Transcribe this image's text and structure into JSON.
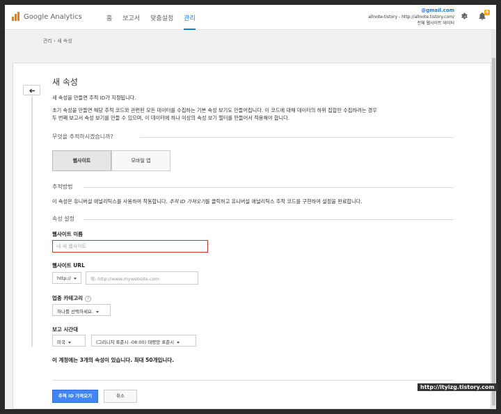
{
  "app": {
    "brand": "Google Analytics"
  },
  "nav": {
    "items": [
      "홈",
      "보고서",
      "맞춤설정",
      "관리"
    ],
    "active": "관리"
  },
  "account": {
    "email": "@gmail.com",
    "property": "allnote-tistory - http://allnote.tistory.com/",
    "view": "전체 웹사이트 데이터",
    "notification_count": "4"
  },
  "breadcrumb": "관리 › 새 속성",
  "form": {
    "title": "새 속성",
    "intro1": "새 속성을 만들면 추적 ID가 지정됩니다.",
    "intro2a": "초기 속성을 만들면 해당 추적 코드와 관련된 모든 데이터를 수집하는 기본 속성 보기도 만들어집니다. 이 코드에 대해 데이터의 하위 집합만 수집하려는 경우",
    "intro2b": "두 번째 보고서 속성 보기를 만들 수 있으며, 이 데이터에 하나 이상의 속성 보기 필터를 만들어서 적용해야 합니다.",
    "track_question": "무엇을 추적하시겠습니까?",
    "track_options": [
      "웹사이트",
      "모바일 앱"
    ],
    "method_heading": "추적방법",
    "method_text_a": "이 속성은 유니버설 애널리틱스를 사용하여 작동합니다. ",
    "method_text_em": "추적 ID 가져오기",
    "method_text_b": "를 클릭하고 유니버설 애널리틱스 추적 코드를 구현하여 설정을 완료합니다.",
    "settings_heading": "속성 설정",
    "site_name_label": "웹사이트 이름",
    "site_name_placeholder": "내 새 웹사이트",
    "site_url_label": "웹사이트 URL",
    "protocol": "http://",
    "url_placeholder": "예: http://www.mywebsite.com",
    "category_label": "업종 카테고리",
    "category_help": "?",
    "category_select": "하나를 선택하세요.",
    "timezone_label": "보고 시간대",
    "country": "미국",
    "timezone": "(그리니치 표준시 -08:00) 태평양 표준시",
    "account_note": "이 계정에는 3개의 속성이 있습니다. 최대 50개입니다.",
    "submit_label": "추적 ID 가져오기",
    "cancel_label": "취소"
  },
  "watermark": "http://ityizg.tistory.com"
}
